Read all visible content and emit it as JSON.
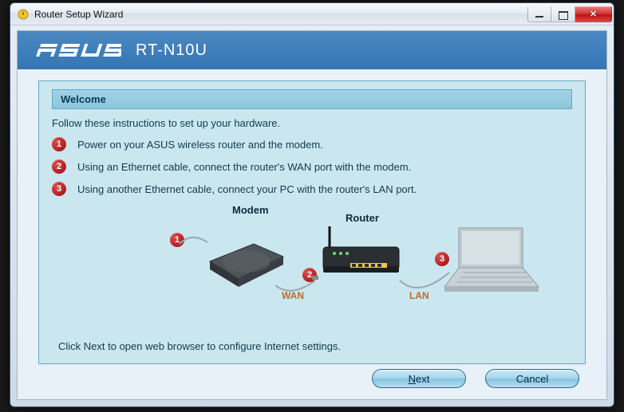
{
  "window": {
    "title": "Router Setup Wizard"
  },
  "header": {
    "brand": "ASUS",
    "model": "RT-N10U"
  },
  "panel": {
    "section_title": "Welcome",
    "intro": "Follow these instructions to set up your hardware.",
    "steps": [
      "Power on your ASUS wireless router and the modem.",
      "Using an Ethernet cable, connect the router's WAN port with the modem.",
      "Using another Ethernet cable, connect your PC with the router's LAN port."
    ],
    "diagram": {
      "modem_label": "Modem",
      "router_label": "Router",
      "wan_label": "WAN",
      "lan_label": "LAN",
      "badge1": "1",
      "badge2": "2",
      "badge3": "3"
    },
    "footnote": "Click Next to open web browser to configure Internet settings."
  },
  "buttons": {
    "next": "Next",
    "cancel": "Cancel"
  }
}
